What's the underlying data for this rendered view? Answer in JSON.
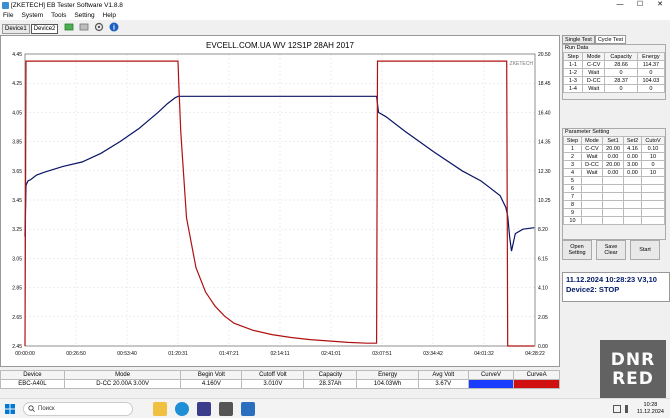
{
  "window": {
    "title": "[ZKETECH] EB Tester Software V1.8.8",
    "controls": [
      "—",
      "☐",
      "✕"
    ]
  },
  "menu": [
    "File",
    "System",
    "Tools",
    "Setting",
    "Help"
  ],
  "toolbar": {
    "icons": [
      "connect-icon",
      "disconnect-icon",
      "settings-icon",
      "info-icon"
    ]
  },
  "device_tabs": [
    "Device1",
    "Device2"
  ],
  "chart": {
    "title": "EVCELL.COM.UA WV 12S1P 28AH 2017",
    "logo": "ZKETECH",
    "voltage_color": "#0a1466",
    "current_color": "#b01010"
  },
  "chart_data": {
    "type": "line",
    "title": "EVCELL.COM.UA WV 12S1P 28AH 2017",
    "x_ticks": [
      "00:00:00",
      "00:26:50",
      "00:53:40",
      "01:20:31",
      "01:47:21",
      "02:14:11",
      "02:41:01",
      "03:07:51",
      "03:34:42",
      "04:01:32",
      "04:28:22"
    ],
    "y_left_ticks": [
      "2.45",
      "2.65",
      "2.85",
      "3.05",
      "3.25",
      "3.45",
      "3.65",
      "3.85",
      "4.05",
      "4.25",
      "4.45"
    ],
    "y_right_ticks": [
      "0.00",
      "2.05",
      "4.10",
      "6.15",
      "8.20",
      "10.25",
      "12.30",
      "14.35",
      "16.40",
      "18.45",
      "20.50"
    ],
    "x_minutes_range": [
      0,
      268.37
    ],
    "y_left_range": [
      2.45,
      4.45
    ],
    "y_right_range": [
      0,
      20.5
    ],
    "series": [
      {
        "role": "voltage",
        "axis": "left",
        "x": [
          0,
          0.5,
          1.5,
          3,
          6,
          10,
          20,
          30,
          40,
          50,
          60,
          70,
          75,
          79,
          80.5,
          81,
          100,
          120,
          140,
          160,
          175,
          185,
          186,
          190,
          200,
          215,
          230,
          240,
          245,
          250,
          253,
          254,
          255,
          256,
          258,
          262,
          268
        ],
        "y": [
          3.2,
          3.55,
          3.58,
          3.59,
          3.62,
          3.64,
          3.68,
          3.71,
          3.77,
          3.85,
          3.94,
          4.05,
          4.11,
          4.15,
          4.16,
          4.16,
          4.16,
          4.16,
          4.16,
          4.16,
          4.16,
          4.16,
          4.05,
          4.02,
          3.92,
          3.78,
          3.65,
          3.58,
          3.53,
          3.48,
          3.4,
          3.34,
          3.2,
          3.1,
          3.22,
          3.25,
          3.26
        ]
      },
      {
        "role": "current",
        "axis": "right",
        "x": [
          0,
          0.5,
          80.5,
          81,
          82,
          85,
          90,
          95,
          100,
          105,
          110,
          120,
          130,
          140,
          150,
          160,
          170,
          180,
          185,
          185.5,
          253.5,
          254,
          268
        ],
        "y": [
          0,
          20,
          20,
          18.2,
          15,
          9,
          5.5,
          3.8,
          2.8,
          2.1,
          1.6,
          1.1,
          0.8,
          0.6,
          0.45,
          0.35,
          0.25,
          0.2,
          0.2,
          20,
          20,
          0,
          0
        ]
      }
    ]
  },
  "right_panel": {
    "tabs": [
      "Single Test",
      "Cycle Test"
    ],
    "run_data": {
      "title": "Run Data",
      "headers": [
        "Step",
        "Mode",
        "Capacity",
        "Energy"
      ],
      "rows": [
        [
          "1-1",
          "C-CV",
          "28.66",
          "114.37"
        ],
        [
          "1-2",
          "Wait",
          "0",
          "0"
        ],
        [
          "1-3",
          "D-CC",
          "28.37",
          "104.03"
        ],
        [
          "1-4",
          "Wait",
          "0",
          "0"
        ]
      ]
    },
    "parameter_setting": {
      "title": "Parameter Setting",
      "headers": [
        "Step",
        "Mode",
        "Set1",
        "Set2",
        "CutoV"
      ],
      "rows": [
        [
          "1",
          "C-CV",
          "20.00",
          "4.16",
          "0.10"
        ],
        [
          "2",
          "Wait",
          "0.00",
          "0.00",
          "10"
        ],
        [
          "3",
          "D-CC",
          "20.00",
          "3.00",
          "0"
        ],
        [
          "4",
          "Wait",
          "0.00",
          "0.00",
          "10"
        ],
        [
          "5",
          "",
          "",
          "",
          ""
        ],
        [
          "6",
          "",
          "",
          "",
          ""
        ],
        [
          "7",
          "",
          "",
          "",
          ""
        ],
        [
          "8",
          "",
          "",
          "",
          ""
        ],
        [
          "9",
          "",
          "",
          "",
          ""
        ],
        [
          "10",
          "",
          "",
          "",
          ""
        ]
      ]
    },
    "buttons": [
      {
        "top": "Open",
        "bottom": "Setting"
      },
      {
        "top": "Save",
        "bottom": "Clear"
      },
      {
        "top": "Start",
        "bottom": ""
      }
    ],
    "status": {
      "line1": "11.12.2024 10:28:23  V3,10",
      "line2": "Device2: STOP"
    }
  },
  "bottom_table": {
    "headers": [
      "Device",
      "Mode",
      "Begin Volt",
      "Cutoff Volt",
      "Capacity",
      "Energy",
      "Avg Volt",
      "CurveV",
      "CurveA"
    ],
    "row": [
      "EBC-A40L",
      "D-CC 20.00A 3.00V",
      "4.160V",
      "3.010V",
      "28.37Ah",
      "104.03Wh",
      "3.67V",
      "",
      ""
    ],
    "curveV_color": "#1a3cff",
    "curveA_color": "#d01010"
  },
  "taskbar": {
    "search_placeholder": "Поиск",
    "time": "10:28",
    "date": "11.12.2024",
    "icon_names": [
      "windows-start-icon",
      "search-icon",
      "file-explorer-icon",
      "edge-icon",
      "store-icon",
      "app-icon",
      "app2-icon"
    ]
  },
  "watermark": {
    "line1": "DNR",
    "line2": "RED"
  }
}
